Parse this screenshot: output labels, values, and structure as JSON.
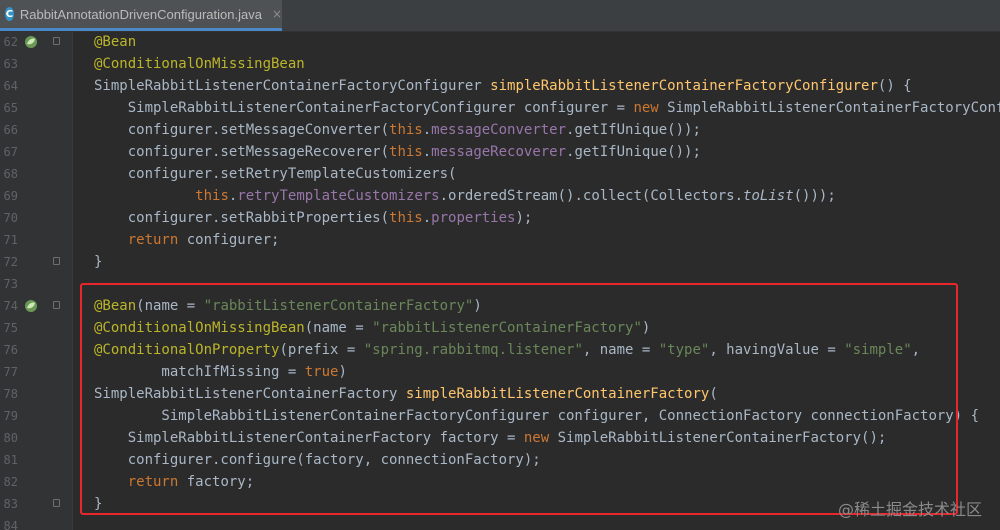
{
  "tab": {
    "filename": "RabbitAnnotationDrivenConfiguration.java",
    "icon": "c-class-icon",
    "icon_letter": "C",
    "close": "×"
  },
  "gutter": {
    "bean_lines": [
      "62",
      "74"
    ],
    "fold_icons": true
  },
  "colors": {
    "annotation": "#bbb529",
    "keyword": "#cc7832",
    "string": "#6a8759",
    "method": "#ffc66d",
    "field": "#9876aa",
    "highlight_box": "#e8262b"
  },
  "lines": [
    {
      "num": "62",
      "tokens": [
        [
          "ann",
          "@Bean"
        ]
      ]
    },
    {
      "num": "63",
      "tokens": [
        [
          "ann",
          "@ConditionalOnMissingBean"
        ]
      ]
    },
    {
      "num": "64",
      "tokens": [
        [
          "",
          "SimpleRabbitListenerContainerFactoryConfigurer "
        ],
        [
          "fn",
          "simpleRabbitListenerContainerFactoryConfigurer"
        ],
        [
          "",
          "() {"
        ]
      ]
    },
    {
      "num": "65",
      "tokens": [
        [
          "",
          "    SimpleRabbitListenerContainerFactoryConfigurer configurer = "
        ],
        [
          "kw",
          "new"
        ],
        [
          "",
          " SimpleRabbitListenerContainerFactoryConfigurer"
        ]
      ]
    },
    {
      "num": "66",
      "tokens": [
        [
          "",
          "    configurer.setMessageConverter("
        ],
        [
          "kw",
          "this"
        ],
        [
          "",
          "."
        ],
        [
          "fld",
          "messageConverter"
        ],
        [
          "",
          ".getIfUnique());"
        ]
      ]
    },
    {
      "num": "67",
      "tokens": [
        [
          "",
          "    configurer.setMessageRecoverer("
        ],
        [
          "kw",
          "this"
        ],
        [
          "",
          "."
        ],
        [
          "fld",
          "messageRecoverer"
        ],
        [
          "",
          ".getIfUnique());"
        ]
      ]
    },
    {
      "num": "68",
      "tokens": [
        [
          "",
          "    configurer.setRetryTemplateCustomizers("
        ]
      ]
    },
    {
      "num": "69",
      "tokens": [
        [
          "",
          "            "
        ],
        [
          "kw",
          "this"
        ],
        [
          "",
          "."
        ],
        [
          "fld",
          "retryTemplateCustomizers"
        ],
        [
          "",
          ".orderedStream().collect(Collectors."
        ],
        [
          "ital",
          "toList"
        ],
        [
          "",
          "()));"
        ]
      ]
    },
    {
      "num": "70",
      "tokens": [
        [
          "",
          "    configurer.setRabbitProperties("
        ],
        [
          "kw",
          "this"
        ],
        [
          "",
          "."
        ],
        [
          "fld",
          "properties"
        ],
        [
          "",
          ");"
        ]
      ]
    },
    {
      "num": "71",
      "tokens": [
        [
          "",
          "    "
        ],
        [
          "kw",
          "return"
        ],
        [
          "",
          " configurer;"
        ]
      ]
    },
    {
      "num": "72",
      "tokens": [
        [
          "",
          "}"
        ]
      ]
    },
    {
      "num": "73",
      "tokens": []
    },
    {
      "num": "74",
      "tokens": [
        [
          "ann",
          "@Bean"
        ],
        [
          "",
          "(name = "
        ],
        [
          "str",
          "\"rabbitListenerContainerFactory\""
        ],
        [
          "",
          ")"
        ]
      ]
    },
    {
      "num": "75",
      "tokens": [
        [
          "ann",
          "@ConditionalOnMissingBean"
        ],
        [
          "",
          "(name = "
        ],
        [
          "str",
          "\"rabbitListenerContainerFactory\""
        ],
        [
          "",
          ")"
        ]
      ]
    },
    {
      "num": "76",
      "tokens": [
        [
          "ann",
          "@ConditionalOnProperty"
        ],
        [
          "",
          "(prefix = "
        ],
        [
          "str",
          "\"spring.rabbitmq.listener\""
        ],
        [
          "",
          ", name = "
        ],
        [
          "str",
          "\"type\""
        ],
        [
          "",
          ", havingValue = "
        ],
        [
          "str",
          "\"simple\""
        ],
        [
          "",
          ","
        ]
      ]
    },
    {
      "num": "77",
      "tokens": [
        [
          "",
          "        matchIfMissing = "
        ],
        [
          "kw",
          "true"
        ],
        [
          "",
          ")"
        ]
      ]
    },
    {
      "num": "78",
      "tokens": [
        [
          "",
          "SimpleRabbitListenerContainerFactory "
        ],
        [
          "fn",
          "simpleRabbitListenerContainerFactory"
        ],
        [
          "",
          "("
        ]
      ]
    },
    {
      "num": "79",
      "tokens": [
        [
          "",
          "        SimpleRabbitListenerContainerFactoryConfigurer configurer, ConnectionFactory connectionFactory) {"
        ]
      ]
    },
    {
      "num": "80",
      "tokens": [
        [
          "",
          "    SimpleRabbitListenerContainerFactory factory = "
        ],
        [
          "kw",
          "new"
        ],
        [
          "",
          " SimpleRabbitListenerContainerFactory();"
        ]
      ]
    },
    {
      "num": "81",
      "tokens": [
        [
          "",
          "    configurer.configure(factory, connectionFactory);"
        ]
      ]
    },
    {
      "num": "82",
      "tokens": [
        [
          "",
          "    "
        ],
        [
          "kw",
          "return"
        ],
        [
          "",
          " factory;"
        ]
      ]
    },
    {
      "num": "83",
      "tokens": [
        [
          "",
          "}"
        ]
      ]
    },
    {
      "num": "84",
      "tokens": []
    }
  ],
  "watermark": "@稀土掘金技术社区"
}
